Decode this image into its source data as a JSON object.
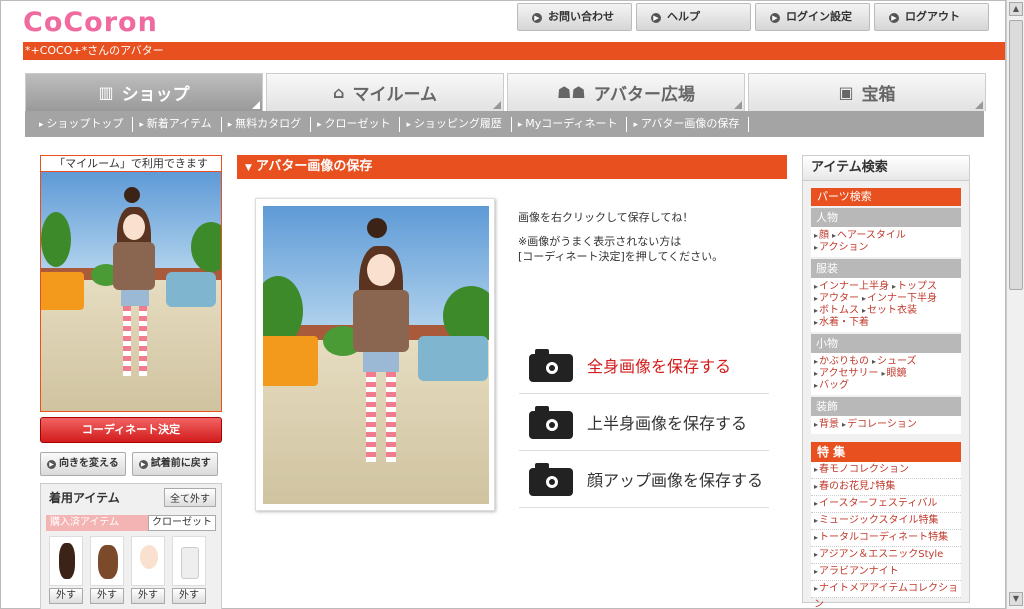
{
  "header": {
    "logo": "CoCoron",
    "top_links": [
      "お問い合わせ",
      "ヘルプ",
      "ログイン設定",
      "ログアウト"
    ],
    "user_avatar_title": "*+COCO+*さんのアバター"
  },
  "tabs": [
    {
      "label": "ショップ",
      "icon": "shop-icon",
      "active": true
    },
    {
      "label": "マイルーム",
      "icon": "house-icon",
      "active": false
    },
    {
      "label": "アバター広場",
      "icon": "people-icon",
      "active": false
    },
    {
      "label": "宝箱",
      "icon": "treasure-box-icon",
      "active": false
    }
  ],
  "subnav": [
    "ショップトップ",
    "新着アイテム",
    "無料カタログ",
    "クローゼット",
    "ショッピング履歴",
    "Myコーディネート",
    "アバター画像の保存"
  ],
  "left": {
    "avatar_caption": "「マイルーム」で利用できます",
    "coordinate_button": "コーディネート決定",
    "turn_button": "向きを変える",
    "reset_button": "試着前に戻す",
    "wear_title": "着用アイテム",
    "remove_all": "全て外す",
    "purchased_tab": "購入済アイテム",
    "closet_tab": "クローゼット",
    "remove_label": "外す"
  },
  "main": {
    "section_title": "アバター画像の保存",
    "instruction_1": "画像を右クリックして保存してね！",
    "instruction_2a": "※画像がうまく表示されない方は",
    "instruction_2b": "[コーディネート決定]を押してください。",
    "save_options": [
      {
        "label": "全身画像を保存する",
        "highlight": true
      },
      {
        "label": "上半身画像を保存する",
        "highlight": false
      },
      {
        "label": "顔アップ画像を保存する",
        "highlight": false
      }
    ]
  },
  "right": {
    "title": "アイテム検索",
    "parts_search": "パーツ検索",
    "categories": [
      {
        "name": "人物",
        "links": [
          "顔",
          "ヘアースタイル",
          "アクション"
        ]
      },
      {
        "name": "服装",
        "links": [
          "インナー上半身",
          "トップス",
          "アウター",
          "インナー下半身",
          "ボトムス",
          "セット衣装",
          "水着・下着"
        ]
      },
      {
        "name": "小物",
        "links": [
          "かぶりもの",
          "シューズ",
          "アクセサリー",
          "眼鏡",
          "バッグ"
        ]
      },
      {
        "name": "装飾",
        "links": [
          "背景",
          "デコレーション"
        ]
      }
    ],
    "feature_title": "特 集",
    "features": [
      "春モノコレクション",
      "春のお花見♪特集",
      "イースターフェスティバル",
      "ミュージックスタイル特集",
      "トータルコーディネート特集",
      "アジアン＆エスニックStyle",
      "アラビアンナイト",
      "ナイトメアアイテムコレクション"
    ]
  },
  "colors": {
    "accent": "#e8501f",
    "logo": "#f06aa0",
    "button_red": "#d21c1c"
  }
}
